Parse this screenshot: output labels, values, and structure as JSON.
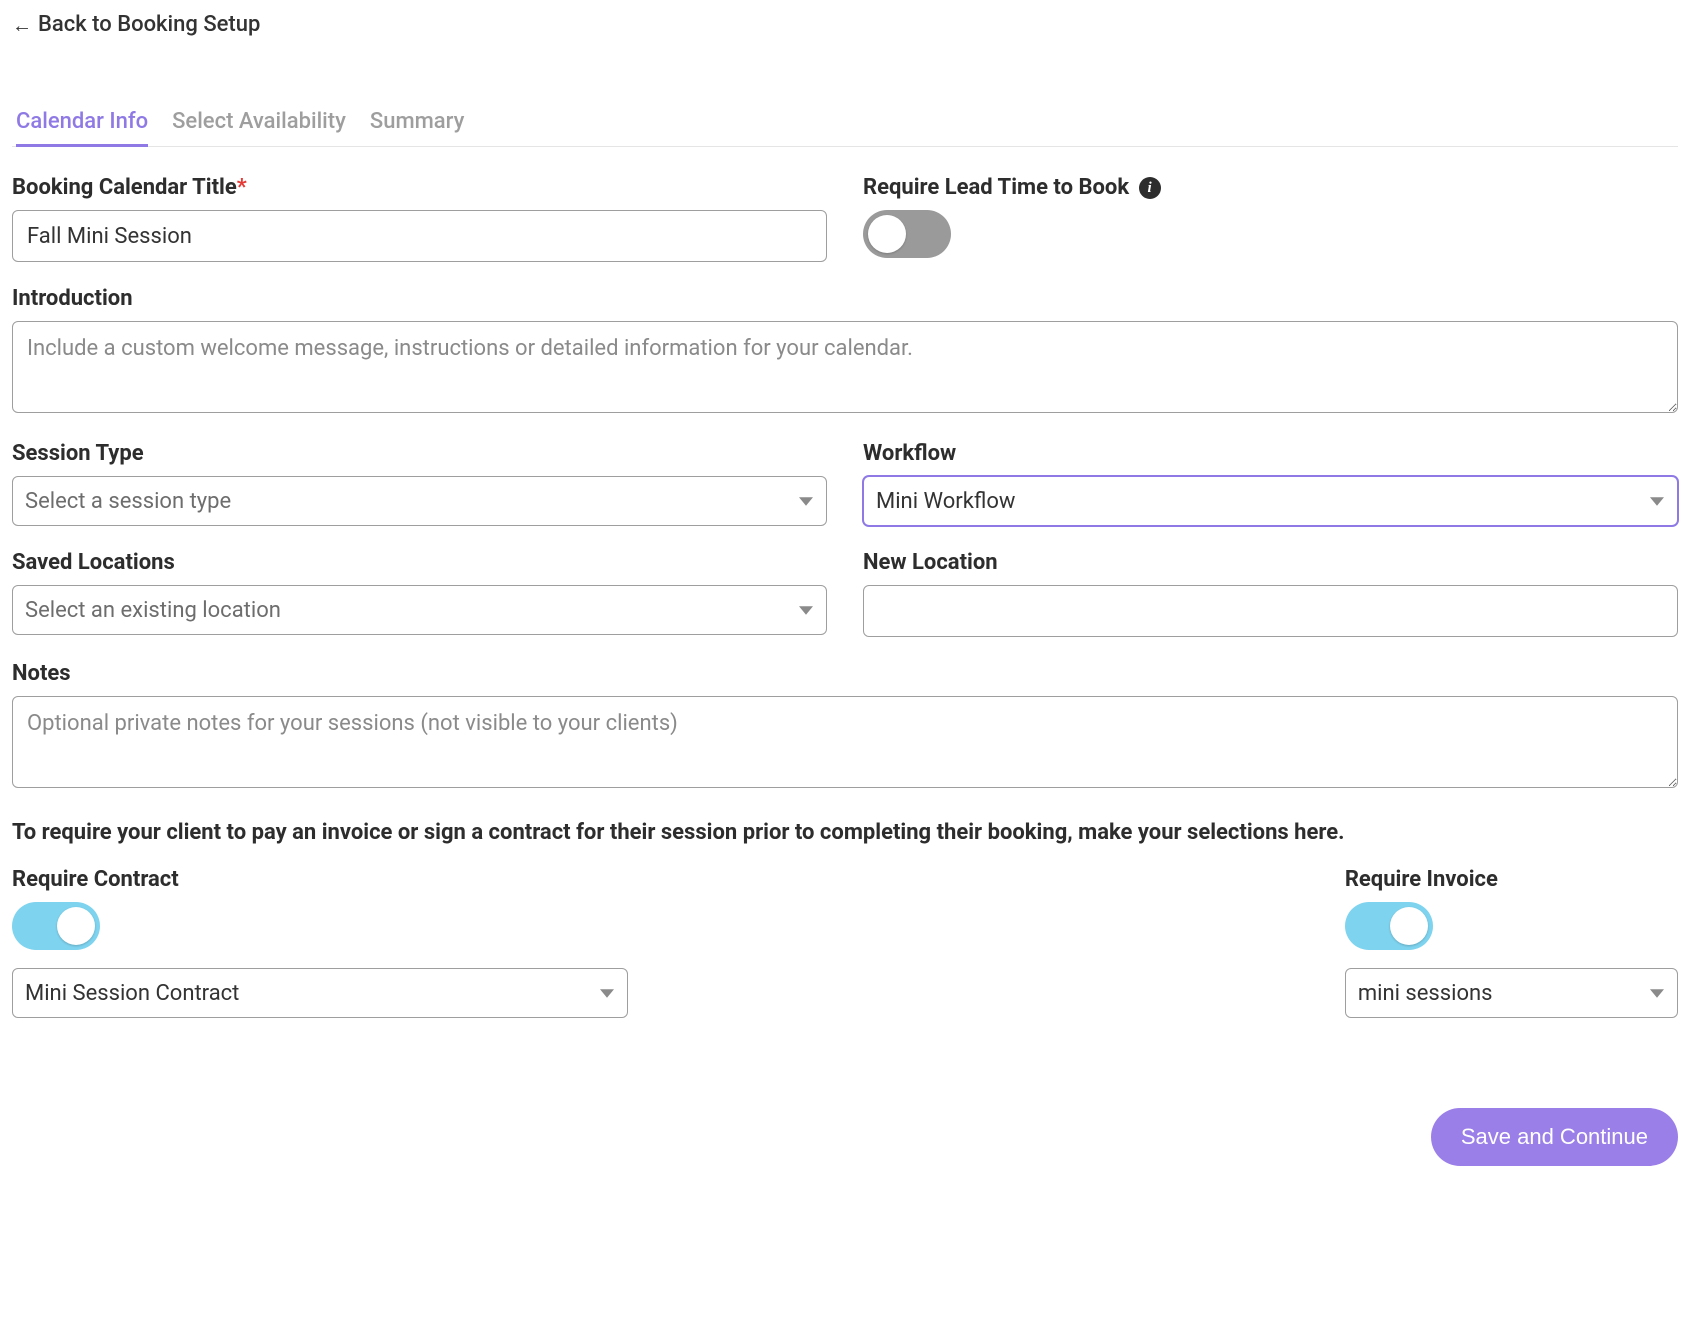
{
  "back_link": "Back to Booking Setup",
  "tabs": {
    "calendar_info": "Calendar Info",
    "select_availability": "Select Availability",
    "summary": "Summary"
  },
  "fields": {
    "title": {
      "label": "Booking Calendar Title",
      "value": "Fall Mini Session"
    },
    "lead_time": {
      "label": "Require Lead Time to Book ",
      "enabled": false
    },
    "introduction": {
      "label": "Introduction",
      "placeholder": "Include a custom welcome message, instructions or detailed information for your calendar.",
      "value": ""
    },
    "session_type": {
      "label": "Session Type",
      "placeholder": "Select a session type",
      "value": ""
    },
    "workflow": {
      "label": "Workflow",
      "value": "Mini Workflow"
    },
    "saved_locations": {
      "label": "Saved Locations",
      "placeholder": "Select an existing location",
      "value": ""
    },
    "new_location": {
      "label": "New Location",
      "value": ""
    },
    "notes": {
      "label": "Notes",
      "placeholder": "Optional private notes for your sessions (not visible to your clients)",
      "value": ""
    }
  },
  "require_section": {
    "intro_text": "To require your client to pay an invoice or sign a contract for their session prior to completing their booking, make your selections here.",
    "contract": {
      "label": "Require Contract",
      "enabled": true,
      "selected": "Mini Session Contract"
    },
    "invoice": {
      "label": "Require Invoice",
      "enabled": true,
      "selected": "mini sessions"
    }
  },
  "buttons": {
    "save_continue": "Save and Continue"
  }
}
